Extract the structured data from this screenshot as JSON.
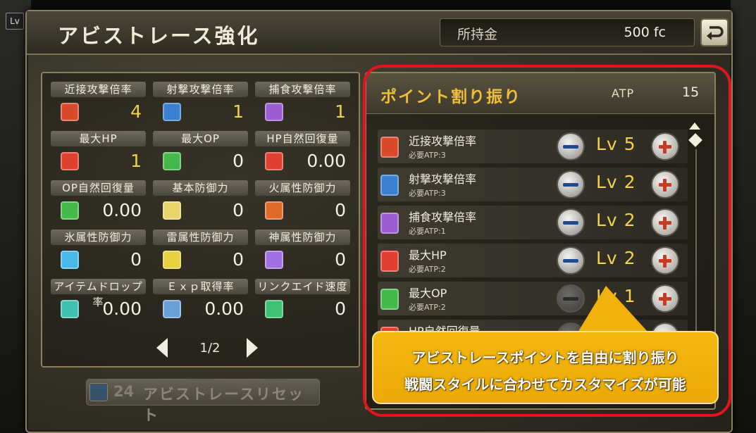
{
  "corner": {
    "lv": "Lv"
  },
  "header": {
    "title": "アビストレース強化",
    "money_label": "所持金",
    "money_value": "500 fc"
  },
  "stats": {
    "items": [
      {
        "label": "近接攻撃倍率",
        "value": "4",
        "icon": "melee-sword-icon",
        "color": "#d94a2a",
        "highlight": "yellow"
      },
      {
        "label": "射撃攻撃倍率",
        "value": "1",
        "icon": "gun-icon",
        "color": "#3a7fd0",
        "highlight": "yellow"
      },
      {
        "label": "捕食攻撃倍率",
        "value": "1",
        "icon": "predation-jaw-icon",
        "color": "#9d5dd0",
        "highlight": "yellow"
      },
      {
        "label": "最大HP",
        "value": "1",
        "icon": "hp-up-icon",
        "color": "#e04030",
        "highlight": "yellow"
      },
      {
        "label": "最大OP",
        "value": "0",
        "icon": "op-up-icon",
        "color": "#45b84a",
        "highlight": "white"
      },
      {
        "label": "HP自然回復量",
        "value": "0.00",
        "icon": "hp-regen-icon",
        "color": "#e04030",
        "highlight": "white"
      },
      {
        "label": "OP自然回復量",
        "value": "0.00",
        "icon": "op-regen-icon",
        "color": "#45b84a",
        "highlight": "white"
      },
      {
        "label": "基本防御力",
        "value": "0",
        "icon": "defense-card-icon",
        "color": "#e8d46a",
        "highlight": "white"
      },
      {
        "label": "火属性防御力",
        "value": "0",
        "icon": "fire-icon",
        "color": "#e06a2a",
        "highlight": "white"
      },
      {
        "label": "氷属性防御力",
        "value": "0",
        "icon": "ice-icon",
        "color": "#4ab8e8",
        "highlight": "white"
      },
      {
        "label": "雷属性防御力",
        "value": "0",
        "icon": "thunder-icon",
        "color": "#e8d040",
        "highlight": "white"
      },
      {
        "label": "神属性防御力",
        "value": "0",
        "icon": "divine-icon",
        "color": "#a070e0",
        "highlight": "white"
      },
      {
        "label": "アイテムドロップ率",
        "value": "0.00",
        "icon": "item-drop-icon",
        "color": "#40c0b0",
        "highlight": "white"
      },
      {
        "label": "Ｅｘｐ取得率",
        "value": "0.00",
        "icon": "exp-icon",
        "color": "#6aa0d8",
        "highlight": "white"
      },
      {
        "label": "リンクエイド速度",
        "value": "0",
        "icon": "link-aid-icon",
        "color": "#40c070",
        "highlight": "white"
      }
    ],
    "page": "1/2"
  },
  "reset": {
    "count": "24",
    "label": "アビストレースリセット"
  },
  "points": {
    "title": "ポイント割り振り",
    "atp_label": "ATP",
    "atp_value": "15",
    "rows": [
      {
        "name": "近接攻撃倍率",
        "req": "必要ATP:3",
        "level": "Lv 5",
        "icon": "melee-sword-icon",
        "color": "#d94a2a"
      },
      {
        "name": "射撃攻撃倍率",
        "req": "必要ATP:3",
        "level": "Lv 2",
        "icon": "gun-icon",
        "color": "#3a7fd0"
      },
      {
        "name": "捕食攻撃倍率",
        "req": "必要ATP:1",
        "level": "Lv 2",
        "icon": "predation-jaw-icon",
        "color": "#9d5dd0"
      },
      {
        "name": "最大HP",
        "req": "必要ATP:2",
        "level": "Lv 2",
        "icon": "hp-up-icon",
        "color": "#e04030"
      },
      {
        "name": "最大OP",
        "req": "必要ATP:2",
        "level": "Lv 1",
        "icon": "op-up-icon",
        "color": "#45b84a"
      },
      {
        "name": "HP自然回復量",
        "req": "",
        "level": "",
        "icon": "hp-regen-icon",
        "color": "#e04030"
      }
    ]
  },
  "callout": {
    "line1": "アビストレースポイントを自由に割り振り",
    "line2": "戦闘スタイルに合わせてカスタマイズが可能"
  },
  "colors": {
    "accent_gold": "#f0bf3a",
    "value_yellow": "#f3d24a",
    "frame_red": "#e3141c",
    "callout_orange": "#f0b20b"
  }
}
